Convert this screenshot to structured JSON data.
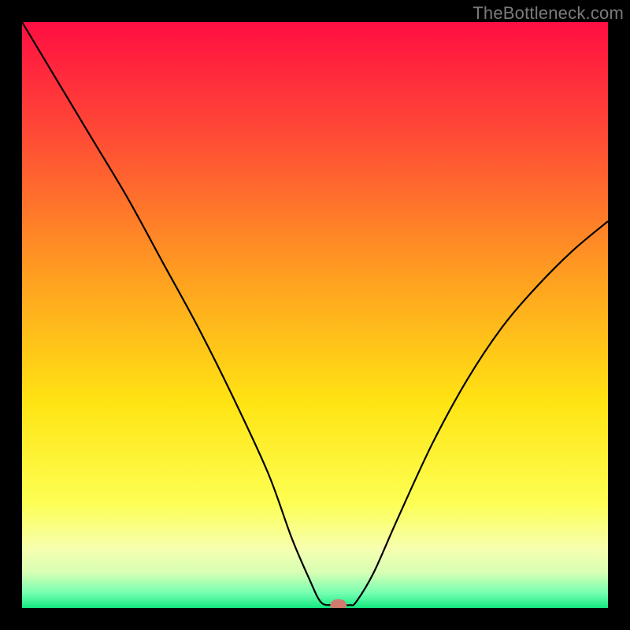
{
  "watermark": "TheBottleneck.com",
  "chart_data": {
    "type": "line",
    "title": "",
    "xlabel": "",
    "ylabel": "",
    "xlim": [
      0,
      100
    ],
    "ylim": [
      0,
      100
    ],
    "background_gradient": {
      "stops": [
        {
          "offset": 0.0,
          "color": "#ff0e42"
        },
        {
          "offset": 0.2,
          "color": "#ff4d35"
        },
        {
          "offset": 0.45,
          "color": "#ffa41f"
        },
        {
          "offset": 0.65,
          "color": "#ffe413"
        },
        {
          "offset": 0.82,
          "color": "#fdff53"
        },
        {
          "offset": 0.9,
          "color": "#f6ffb0"
        },
        {
          "offset": 0.94,
          "color": "#d6ffb4"
        },
        {
          "offset": 0.975,
          "color": "#73ffb0"
        },
        {
          "offset": 1.0,
          "color": "#14e880"
        }
      ]
    },
    "series": [
      {
        "name": "bottleneck-curve",
        "color": "#000000",
        "width": 2.2,
        "x": [
          0,
          6,
          12,
          18,
          24,
          30,
          36,
          42,
          46,
          49,
          51,
          53,
          55,
          56,
          57,
          60,
          64,
          70,
          76,
          82,
          88,
          94,
          100
        ],
        "y": [
          100,
          90,
          80,
          70,
          59,
          48,
          36,
          23,
          12,
          5,
          1,
          0.5,
          0.5,
          0.5,
          1,
          6,
          15,
          28,
          39,
          48,
          55,
          61,
          66
        ]
      }
    ],
    "marker": {
      "name": "optimal-point",
      "x": 54,
      "y": 0.5,
      "rx": 1.4,
      "ry": 1.0,
      "color": "#d17a6e"
    }
  }
}
